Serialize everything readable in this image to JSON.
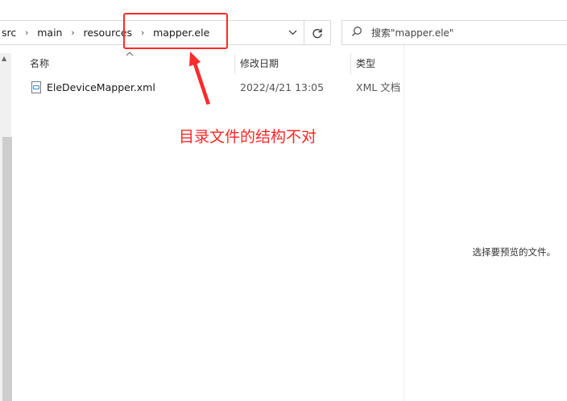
{
  "address": {
    "crumbs": [
      "src",
      "main",
      "resources",
      "mapper.ele"
    ],
    "separator": "›",
    "dropdown_icon": "chevron-down-icon",
    "refresh_icon": "refresh-icon"
  },
  "search": {
    "placeholder": "搜索\"mapper.ele\"",
    "icon": "search-icon"
  },
  "columns": {
    "name": "名称",
    "modified": "修改日期",
    "type": "类型"
  },
  "files": [
    {
      "name": "EleDeviceMapper.xml",
      "modified": "2022/4/21 13:05",
      "type": "XML 文档",
      "icon": "xml-file-icon"
    }
  ],
  "preview": {
    "empty_text": "选择要预览的文件。"
  },
  "annotation": {
    "text": "目录文件的结构不对",
    "color": "#ff2626"
  }
}
